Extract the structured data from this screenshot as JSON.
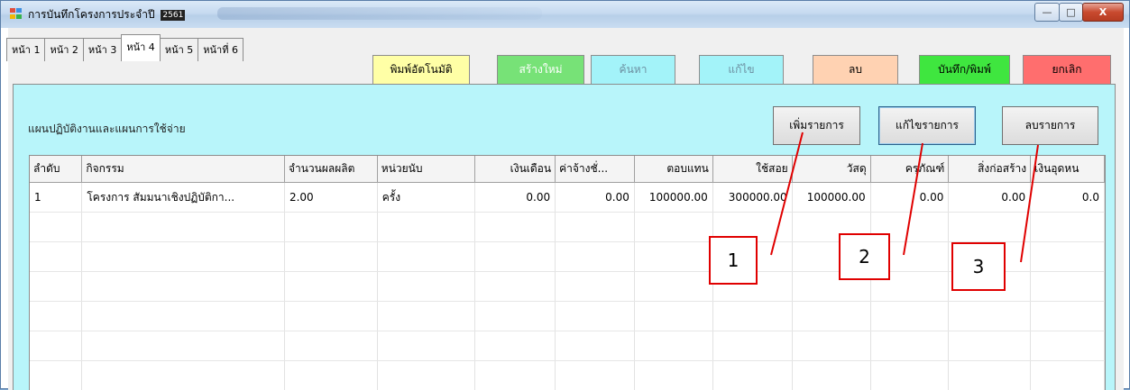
{
  "window": {
    "title": "การบันทึกโครงการประจำปี",
    "year": "2561",
    "controls": {
      "minimize": "—",
      "maximize": "□",
      "close": "X"
    }
  },
  "tabs": [
    {
      "label": "หน้า 1",
      "active": false
    },
    {
      "label": "หน้า 2",
      "active": false
    },
    {
      "label": "หน้า 3",
      "active": false
    },
    {
      "label": "หน้า 4",
      "active": true
    },
    {
      "label": "หน้า 5",
      "active": false
    },
    {
      "label": "หน้าที่ 6",
      "active": false
    }
  ],
  "toolbar": {
    "auto_print": {
      "label": "พิมพ์อัตโนมัติ",
      "bg": "#ffffa6",
      "color": "#000000"
    },
    "create_new": {
      "label": "สร้างใหม่",
      "bg": "#77e277",
      "color": "#ffffff"
    },
    "search": {
      "label": "ค้นหา",
      "bg": "#a3f3f9",
      "color": "#6c8fa0"
    },
    "edit": {
      "label": "แก้ไข",
      "bg": "#a3f3f9",
      "color": "#6c8fa0"
    },
    "delete": {
      "label": "ลบ",
      "bg": "#ffd2b2",
      "color": "#000000"
    },
    "save_print": {
      "label": "บันทึก/พิมพ์",
      "bg": "#3fe63f",
      "color": "#000000"
    },
    "cancel": {
      "label": "ยกเลิก",
      "bg": "#ff6e6e",
      "color": "#000000"
    }
  },
  "panel": {
    "title": "แผนปฏิบัติงานและแผนการใช้จ่าย",
    "bg": "#b8f5fa",
    "add_item": "เพิ่มรายการ",
    "edit_item": "แก้ไขรายการ",
    "delete_item": "ลบรายการ"
  },
  "grid": {
    "columns": [
      "ลำดับ",
      "กิจกรรม",
      "จำนวนผลผลิต",
      "หน่วยนับ",
      "เงินเดือน",
      "ค่าจ้างชั่...",
      "ตอบแทน",
      "ใช้สอย",
      "วัสดุ",
      "ครุภัณฑ์",
      "สิ่งก่อสร้าง",
      "เงินอุดหน"
    ],
    "rows": [
      [
        "1",
        "โครงการ สัมมนาเชิงปฏิบัติกา...",
        "2.00",
        "ครั้ง",
        "0.00",
        "0.00",
        "100000.00",
        "300000.00",
        "100000.00",
        "0.00",
        "0.00",
        "0.0"
      ]
    ]
  },
  "callouts": {
    "one": "1",
    "two": "2",
    "three": "3"
  }
}
